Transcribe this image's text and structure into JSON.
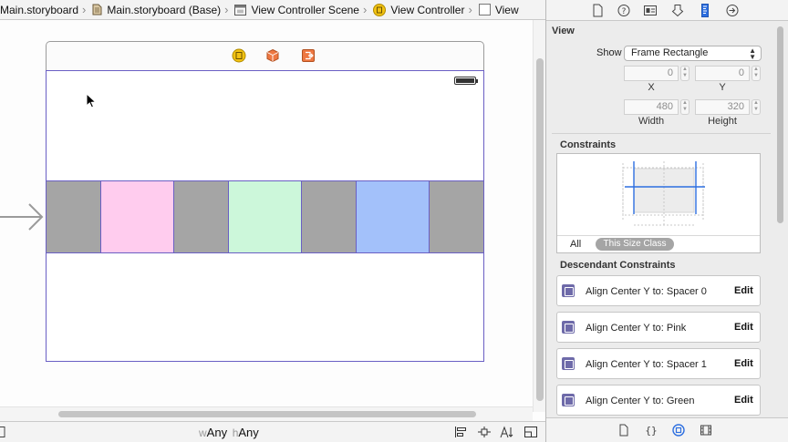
{
  "breadcrumb": [
    {
      "label": "Main.storyboard",
      "icon": "none"
    },
    {
      "label": "Main.storyboard (Base)",
      "icon": "storyboard-file-icon"
    },
    {
      "label": "View Controller Scene",
      "icon": "scene-icon"
    },
    {
      "label": "View Controller",
      "icon": "view-controller-icon"
    },
    {
      "label": "View",
      "icon": "view-icon"
    }
  ],
  "colors": {
    "gray_spacer": "#a5a5a5",
    "pink": "#ffccee",
    "green": "#ccf7da",
    "blue": "#a3c1fa",
    "frame_border": "#6a5fc4",
    "scene_vc_icon": "#f2c212",
    "scene_cube_icon": "#ee7842",
    "scene_exit_icon": "#ee7842"
  },
  "color_row": [
    "gray_spacer",
    "pink",
    "gray_spacer",
    "green",
    "gray_spacer",
    "blue",
    "gray_spacer"
  ],
  "size_class": {
    "w_prefix": "w",
    "w_value": "Any",
    "h_prefix": "h",
    "h_value": "Any"
  },
  "inspector": {
    "section_title": "View",
    "show_label": "Show",
    "show_value": "Frame Rectangle",
    "x_value": "0",
    "y_value": "0",
    "x_label": "X",
    "y_label": "Y",
    "width_value": "480",
    "height_value": "320",
    "width_label": "Width",
    "height_label": "Height",
    "constraints_title": "Constraints",
    "tab_all": "All",
    "tab_size_class": "This Size Class",
    "descendant_title": "Descendant Constraints",
    "descendant_constraints": [
      {
        "text": "Align Center Y to:  Spacer 0",
        "action": "Edit"
      },
      {
        "text": "Align Center Y to:  Pink",
        "action": "Edit"
      },
      {
        "text": "Align Center Y to:  Spacer 1",
        "action": "Edit"
      },
      {
        "text": "Align Center Y to:  Green",
        "action": "Edit"
      }
    ]
  }
}
